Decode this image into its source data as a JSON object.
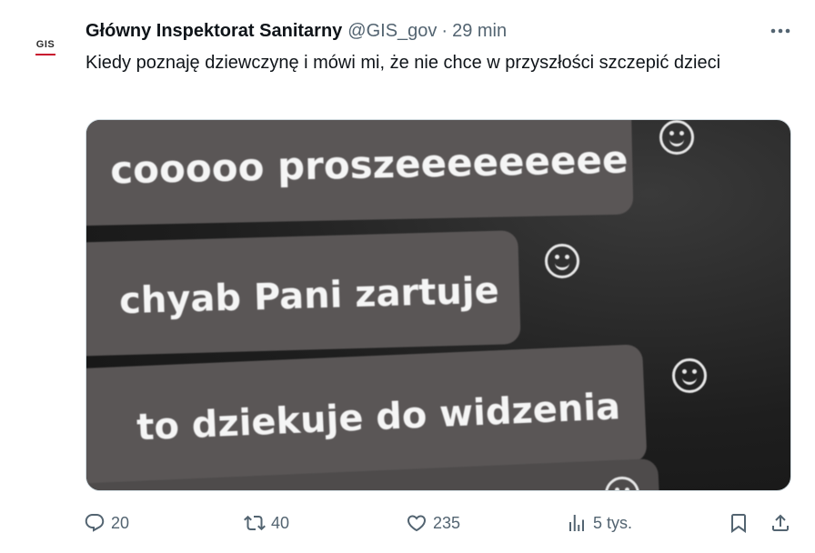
{
  "author": {
    "avatar_text": "GIS",
    "name": "Główny Inspektorat Sanitarny",
    "handle": "@GIS_gov",
    "separator": "·",
    "time": "29 min"
  },
  "tweet": {
    "text": "Kiedy poznaję dziewczynę i mówi mi, że nie chce w przyszłości szczepić dzieci"
  },
  "media": {
    "messages": [
      "cooooo proszeeeeeeeee",
      "chyab Pani zartuje",
      "to dziekuje  do widzenia"
    ]
  },
  "actions": {
    "reply_count": "20",
    "retweet_count": "40",
    "like_count": "235",
    "views_count": "5 tys."
  },
  "icons": {
    "more": "more-horizontal-icon",
    "reply": "reply-icon",
    "retweet": "retweet-icon",
    "like": "heart-icon",
    "views": "views-chart-icon",
    "bookmark": "bookmark-icon",
    "share": "share-icon"
  },
  "colors": {
    "text_primary": "#0f1419",
    "text_secondary": "#536471",
    "logo_accent": "#c8102e"
  }
}
